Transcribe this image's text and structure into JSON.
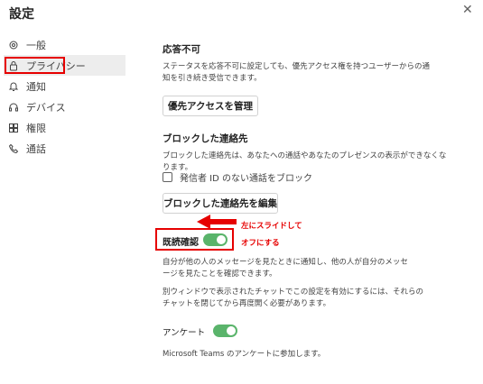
{
  "window": {
    "title": "設定"
  },
  "sidebar": {
    "items": [
      {
        "label": "一般",
        "icon": "gear-icon"
      },
      {
        "label": "プライバシー",
        "icon": "lock-icon",
        "selected": true
      },
      {
        "label": "通知",
        "icon": "bell-icon"
      },
      {
        "label": "デバイス",
        "icon": "headset-icon"
      },
      {
        "label": "権限",
        "icon": "grid-icon"
      },
      {
        "label": "通話",
        "icon": "phone-icon"
      }
    ]
  },
  "dnd": {
    "heading": "応答不可",
    "description": "ステータスを応答不可に設定しても、優先アクセス権を持つユーザーからの通知を引き続き受信できます。",
    "button": "優先アクセスを管理"
  },
  "blocked": {
    "heading": "ブロックした連絡先",
    "description": "ブロックした連絡先は、あなたへの通話やあなたのプレゼンスの表示ができなくなります。",
    "checkbox_label": "発信者 ID のない通話をブロック",
    "checkbox_checked": false,
    "button": "ブロックした連絡先を編集"
  },
  "read_receipts": {
    "label": "既読確認",
    "on": true,
    "description1": "自分が他の人のメッセージを見たときに通知し、他の人が自分のメッセージを見たことを確認できます。",
    "description2": "別ウィンドウで表示されたチャットでこの設定を有効にするには、それらのチャットを閉じてから再度開く必要があります。"
  },
  "annotation": {
    "line1": "左にスライドして",
    "line2": "オフにする",
    "color": "#e60000"
  },
  "survey": {
    "label": "アンケート",
    "on": true,
    "description": "Microsoft Teams のアンケートに参加します。"
  },
  "colors": {
    "toggle_on": "#5ab46b",
    "highlight": "#e60000"
  }
}
